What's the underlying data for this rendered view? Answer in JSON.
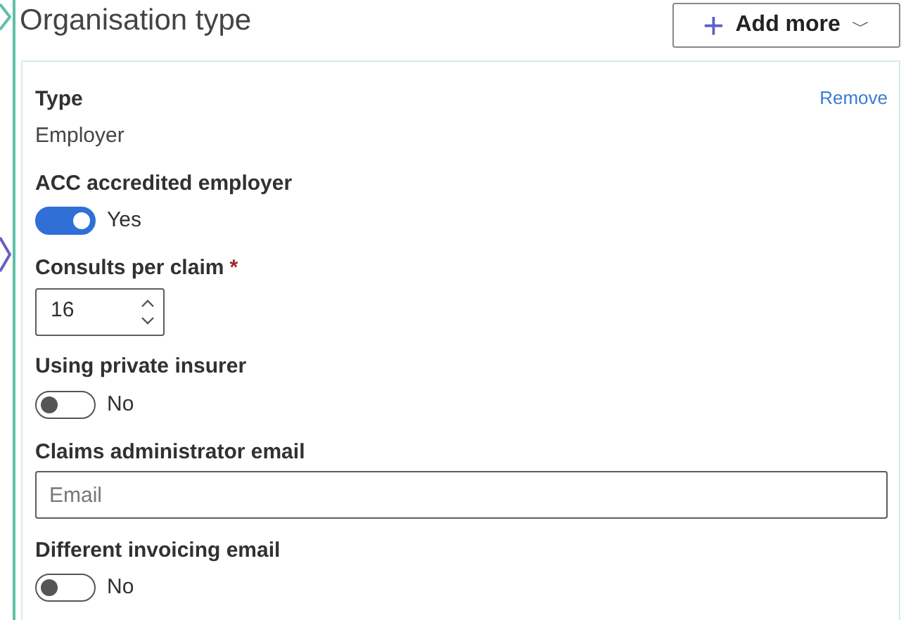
{
  "section": {
    "title": "Organisation type",
    "add_button": {
      "icon": "+",
      "label": "Add more",
      "caret": "﹀"
    }
  },
  "card": {
    "remove_link": "Remove",
    "fields": [
      {
        "kind": "text",
        "label": "Type",
        "value": "Employer"
      },
      {
        "kind": "toggle",
        "label": "ACC accredited employer",
        "on": true,
        "state_text": "Yes"
      },
      {
        "kind": "number",
        "label": "Consults per claim",
        "required": true,
        "required_mark": "*",
        "value": "16"
      },
      {
        "kind": "toggle",
        "label": "Using private insurer",
        "on": false,
        "state_text": "No"
      },
      {
        "kind": "email",
        "label": "Claims administrator email",
        "placeholder": "Email"
      },
      {
        "kind": "toggle",
        "label": "Different invoicing email",
        "on": false,
        "state_text": "No"
      }
    ]
  }
}
